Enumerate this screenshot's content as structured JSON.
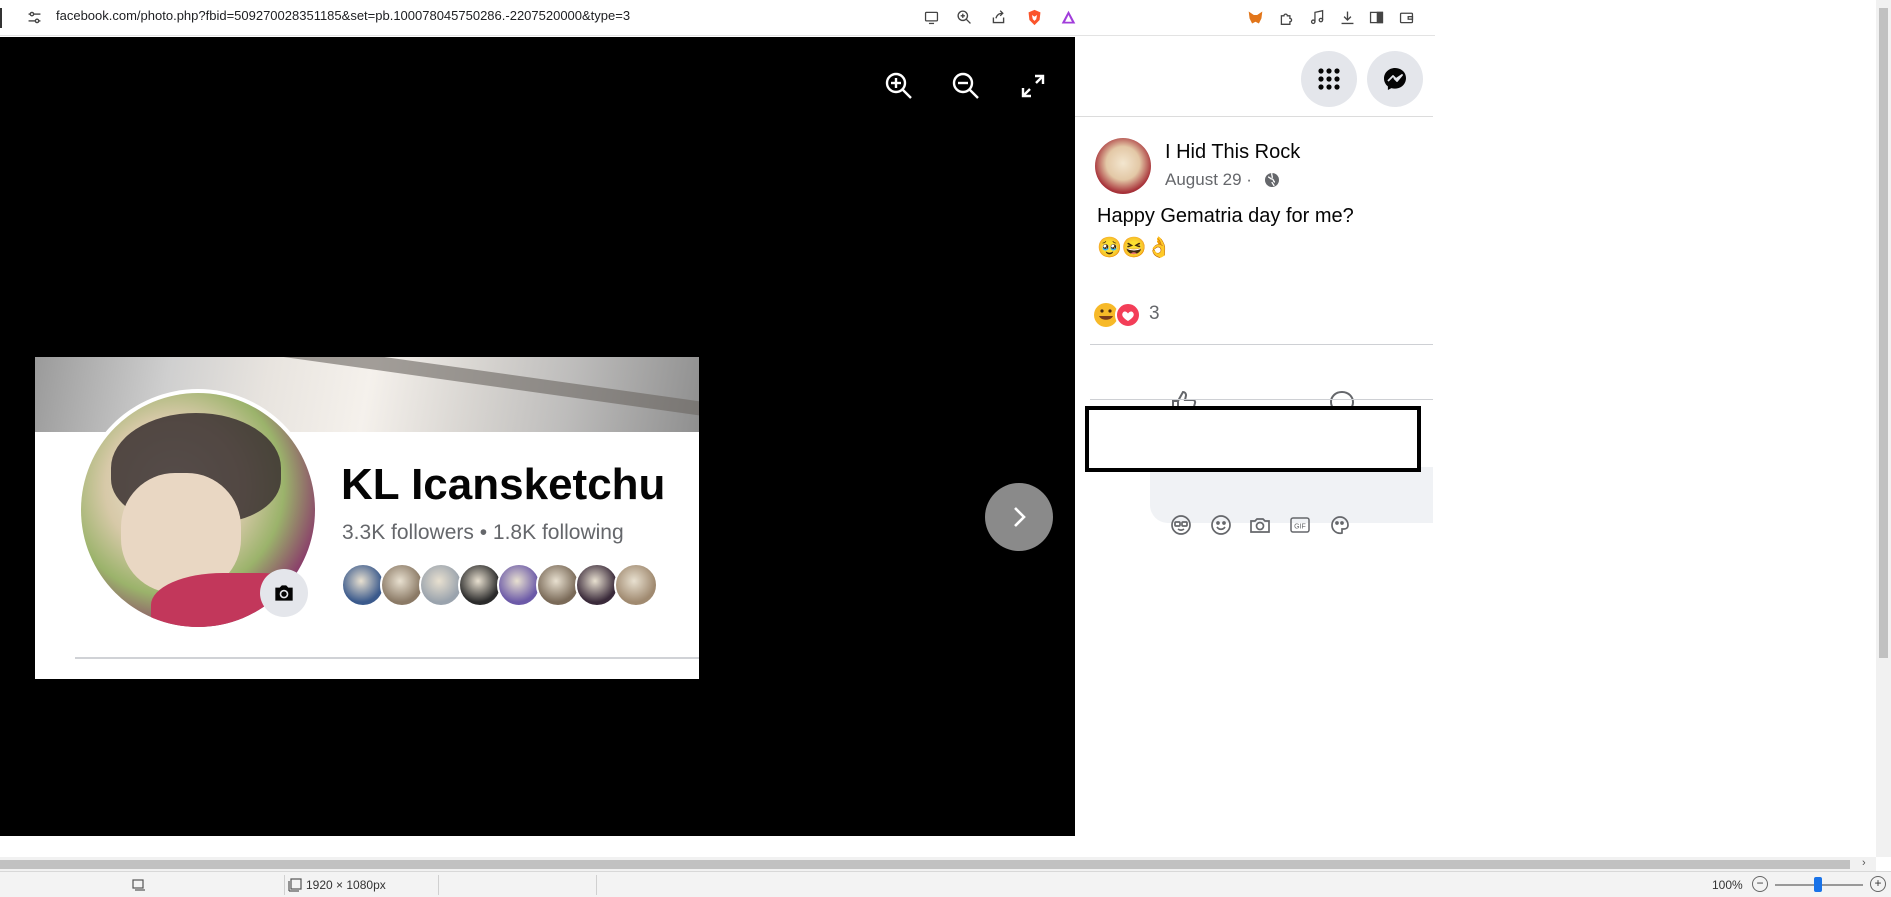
{
  "browser": {
    "url": "facebook.com/photo.php?fbid=509270028351185&set=pb.100078045750286.-2207520000&type=3",
    "icons": [
      "site-settings-icon",
      "cast-icon",
      "zoom-icon",
      "share-icon",
      "brave-shield-icon",
      "rewards-icon",
      "metamask-icon",
      "extensions-icon",
      "media-icon",
      "download-icon",
      "sidebar-icon",
      "wallet-icon"
    ]
  },
  "viewer": {
    "tools": [
      "zoom-in-icon",
      "zoom-out-icon",
      "fullscreen-icon"
    ],
    "photo": {
      "profile_name": "KL Icansketchu",
      "profile_stats": "3.3K followers • 1.8K following",
      "friend_colors": [
        "#3b5a8c",
        "#8b7a66",
        "#9aa3ad",
        "#2b2b2b",
        "#6c5aa8",
        "#7a6a58",
        "#3a2a3a",
        "#a08a70"
      ]
    }
  },
  "post": {
    "page_name": "I Hid This Rock",
    "date": "August 29",
    "date_separator": "·",
    "text": "Happy Gematria day for me?",
    "emojis": "🥹😆👌",
    "reaction_count": "3"
  },
  "statusbar": {
    "dimensions": "1920 × 1080px",
    "zoom": "100%"
  }
}
